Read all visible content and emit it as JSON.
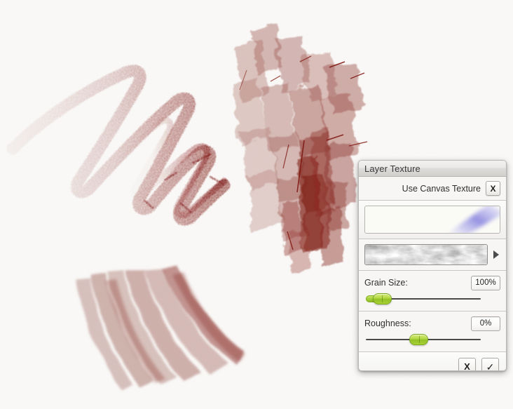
{
  "app": {
    "canvas_bg_color": "#fbfaf8",
    "paint_color": "#8e3a35"
  },
  "panel": {
    "title": "Layer Texture",
    "canvas_texture_row": {
      "label": "Use Canvas Texture",
      "toggle_label": "X"
    },
    "stroke_preview": {
      "name": "stroke-preview",
      "stroke_color": "#8f8ce0"
    },
    "texture_preview": {
      "name": "texture-preview",
      "arrow_label": "▶"
    },
    "sliders": [
      {
        "label": "Grain Size:",
        "value": "100%",
        "percent": 100,
        "knob_pos_pct": 14
      },
      {
        "label": "Roughness:",
        "value": "0%",
        "percent": 0,
        "knob_pos_pct": 46
      }
    ],
    "footer": {
      "cancel_label": "X",
      "confirm_label": "✓"
    }
  }
}
